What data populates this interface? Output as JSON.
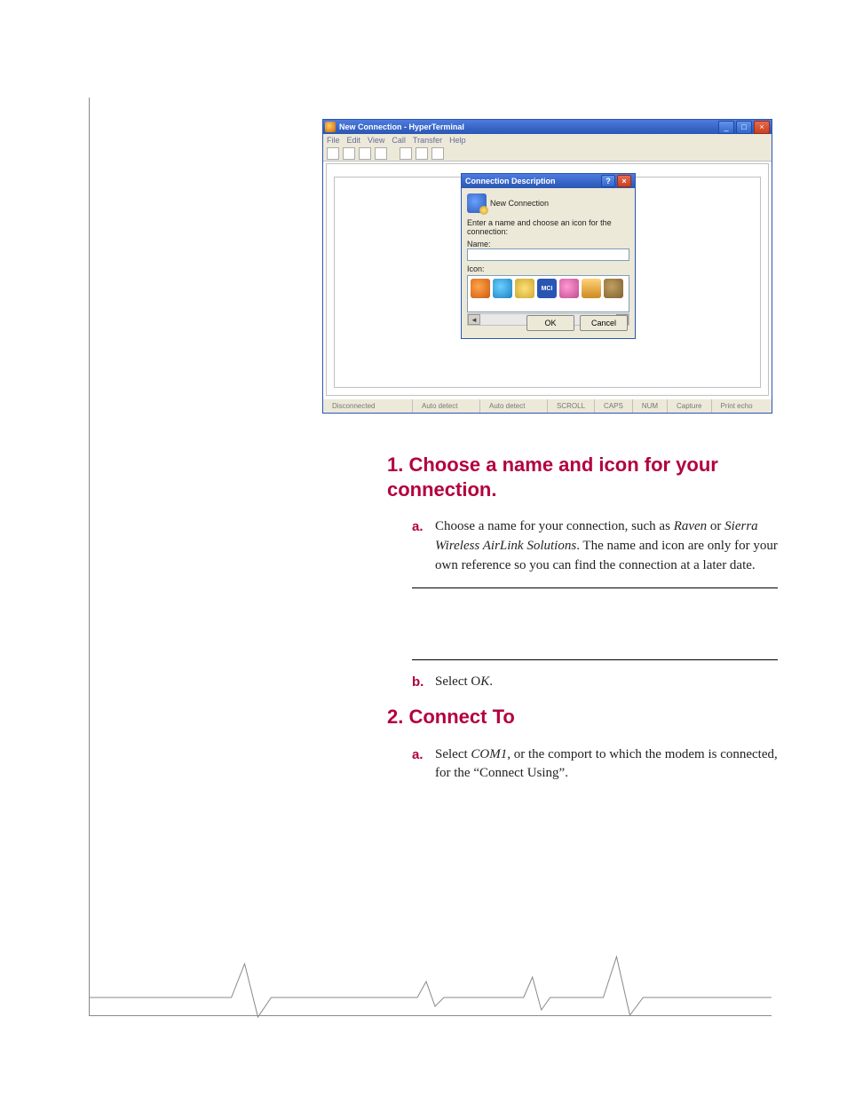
{
  "screenshot": {
    "window_title": "New Connection - HyperTerminal",
    "menu": [
      "File",
      "Edit",
      "View",
      "Call",
      "Transfer",
      "Help"
    ],
    "status": {
      "conn": "Disconnected",
      "auto1": "Auto detect",
      "auto2": "Auto detect",
      "scroll": "SCROLL",
      "caps": "CAPS",
      "num": "NUM",
      "capture": "Capture",
      "print": "Print echo"
    },
    "dialog": {
      "title": "Connection Description",
      "newconn": "New Connection",
      "prompt": "Enter a name and choose an icon for the connection:",
      "name_label": "Name:",
      "icon_label": "Icon:",
      "mci": "MCI",
      "ok": "OK",
      "cancel": "Cancel"
    }
  },
  "section1": {
    "heading": "1. Choose a name and icon for your connection.",
    "a": {
      "bullet": "a.",
      "pre": "Choose a name for your connection, such as ",
      "em1": "Raven",
      "mid": " or ",
      "em2": "Sierra Wireless AirLink Solutions",
      "post": ". The name and icon are only for your own reference so you can find the connection at a later date."
    },
    "b": {
      "bullet": "b.",
      "pre": "Select O",
      "em": "K",
      "post": "."
    }
  },
  "section2": {
    "heading": "2. Connect To",
    "a": {
      "bullet": "a.",
      "pre": "Select ",
      "em": "COM1",
      "post": ", or the comport to which the modem is connected, for the “Connect Using”."
    }
  }
}
